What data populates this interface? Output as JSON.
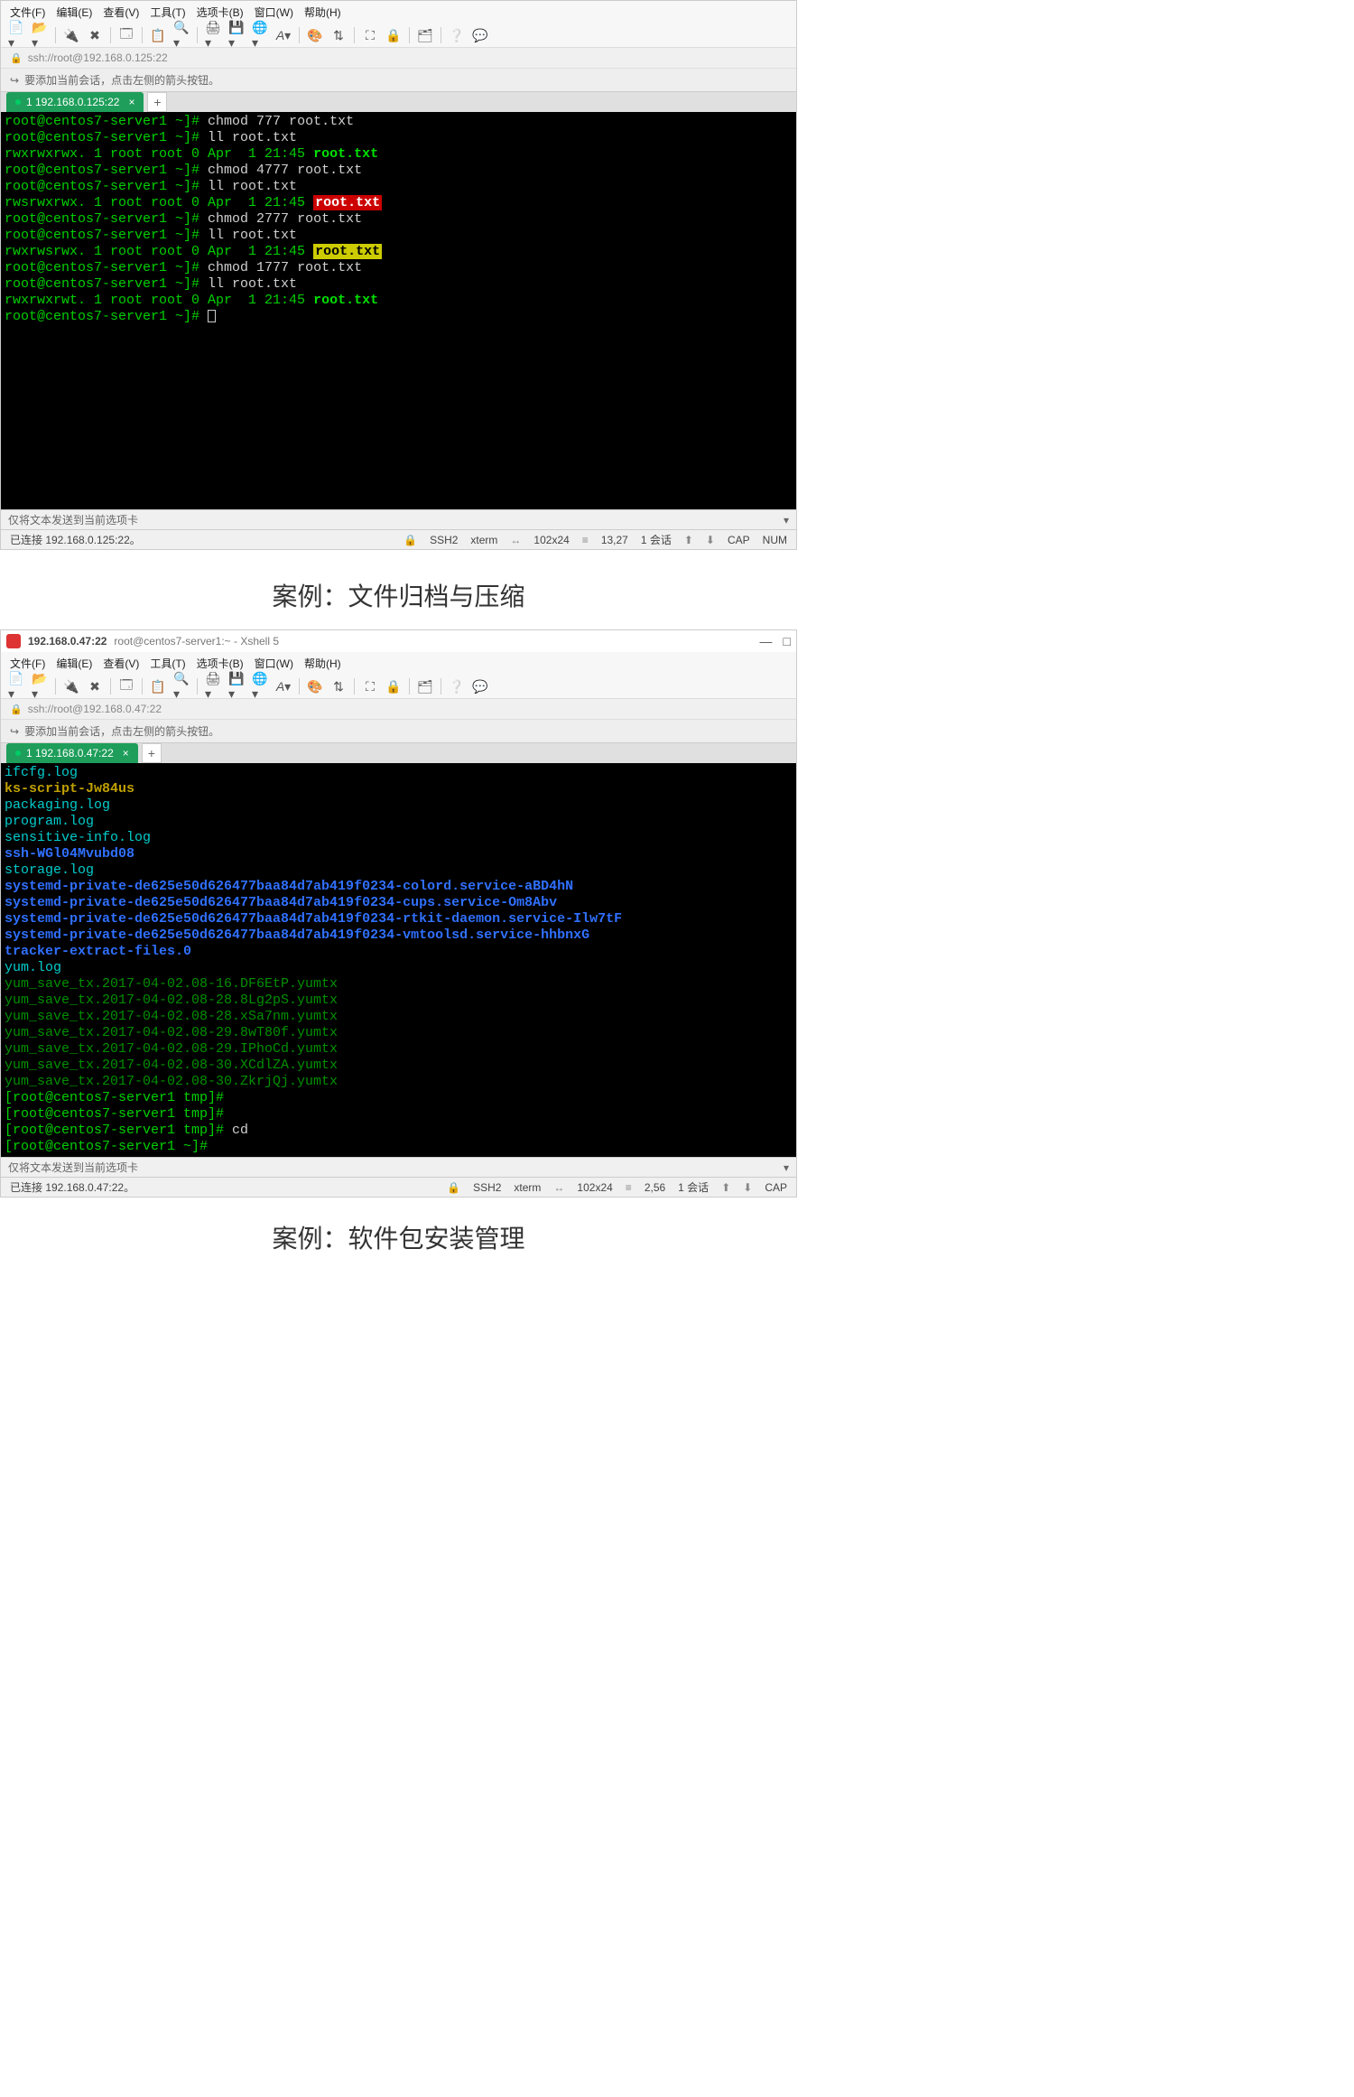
{
  "caption1": "案例：文件归档与压缩",
  "caption2": "案例：软件包安装管理",
  "menus": {
    "file": "文件(F)",
    "edit": "编辑(E)",
    "view": "查看(V)",
    "tools": "工具(T)",
    "tab": "选项卡(B)",
    "window": "窗口(W)",
    "help": "帮助(H)"
  },
  "win1": {
    "address": "ssh://root@192.168.0.125:22",
    "hint": "要添加当前会话，点击左侧的箭头按钮。",
    "tab_label": "1 192.168.0.125:22",
    "tab_plus": "+",
    "input_hint": "仅将文本发送到当前选项卡",
    "status_left": "已连接 192.168.0.125:22。",
    "status": {
      "ssh": "SSH2",
      "term": "xterm",
      "size": "102x24",
      "cursor": "13,27",
      "sess": "1 会话",
      "cap": "CAP",
      "num": "NUM"
    },
    "prompt": "root@centos7-server1 ~]# ",
    "lines": [
      {
        "t": "prompt",
        "cmd": "chmod 777 root.txt"
      },
      {
        "t": "prompt",
        "cmd": "ll root.txt"
      },
      {
        "t": "ls",
        "perm": "rwxrwxrwx. 1 root root 0 Apr  1 21:45 ",
        "file": "root.txt",
        "style": "bold"
      },
      {
        "t": "prompt",
        "cmd": "chmod 4777 root.txt"
      },
      {
        "t": "prompt",
        "cmd": "ll root.txt"
      },
      {
        "t": "ls",
        "perm": "rwsrwxrwx. 1 root root 0 Apr  1 21:45 ",
        "file": "root.txt",
        "style": "red"
      },
      {
        "t": "prompt",
        "cmd": "chmod 2777 root.txt"
      },
      {
        "t": "prompt",
        "cmd": "ll root.txt"
      },
      {
        "t": "ls",
        "perm": "rwxrwsrwx. 1 root root 0 Apr  1 21:45 ",
        "file": "root.txt",
        "style": "yellow"
      },
      {
        "t": "prompt",
        "cmd": "chmod 1777 root.txt"
      },
      {
        "t": "prompt",
        "cmd": "ll root.txt"
      },
      {
        "t": "ls",
        "perm": "rwxrwxrwt. 1 root root 0 Apr  1 21:45 ",
        "file": "root.txt",
        "style": "bold"
      },
      {
        "t": "prompt-cursor"
      }
    ]
  },
  "win2": {
    "title_host": "192.168.0.47:22",
    "title_rest": "root@centos7-server1:~ - Xshell 5",
    "address": "ssh://root@192.168.0.47:22",
    "hint": "要添加当前会话，点击左侧的箭头按钮。",
    "tab_label": "1 192.168.0.47:22",
    "tab_plus": "+",
    "input_hint": "仅将文本发送到当前选项卡",
    "status_left": "已连接 192.168.0.47:22。",
    "status": {
      "ssh": "SSH2",
      "term": "xterm",
      "size": "102x24",
      "cursor": "2,56",
      "sess": "1 会话",
      "cap": "CAP"
    },
    "prompt_tmp": "[root@centos7-server1 tmp]# ",
    "prompt_home": "[root@centos7-server1 ~]# ",
    "files": [
      {
        "name": "ifcfg.log",
        "style": "teal"
      },
      {
        "name": "ks-script-Jw84us",
        "style": "gold"
      },
      {
        "name": "packaging.log",
        "style": "teal"
      },
      {
        "name": "program.log",
        "style": "teal"
      },
      {
        "name": "sensitive-info.log",
        "style": "teal"
      },
      {
        "name": "ssh-WGl04Mvubd08",
        "style": "blue"
      },
      {
        "name": "storage.log",
        "style": "teal"
      },
      {
        "name": "systemd-private-de625e50d626477baa84d7ab419f0234-colord.service-aBD4hN",
        "style": "blue"
      },
      {
        "name": "systemd-private-de625e50d626477baa84d7ab419f0234-cups.service-Om8Abv",
        "style": "blue"
      },
      {
        "name": "systemd-private-de625e50d626477baa84d7ab419f0234-rtkit-daemon.service-Ilw7tF",
        "style": "blue"
      },
      {
        "name": "systemd-private-de625e50d626477baa84d7ab419f0234-vmtoolsd.service-hhbnxG",
        "style": "blue"
      },
      {
        "name": "tracker-extract-files.0",
        "style": "blue"
      },
      {
        "name": "yum.log",
        "style": "teal"
      },
      {
        "name": "yum_save_tx.2017-04-02.08-16.DF6EtP.yumtx",
        "style": "dark"
      },
      {
        "name": "yum_save_tx.2017-04-02.08-28.8Lg2pS.yumtx",
        "style": "dark"
      },
      {
        "name": "yum_save_tx.2017-04-02.08-28.xSa7nm.yumtx",
        "style": "dark"
      },
      {
        "name": "yum_save_tx.2017-04-02.08-29.8wT80f.yumtx",
        "style": "dark"
      },
      {
        "name": "yum_save_tx.2017-04-02.08-29.IPhoCd.yumtx",
        "style": "dark"
      },
      {
        "name": "yum_save_tx.2017-04-02.08-30.XCdlZA.yumtx",
        "style": "dark"
      },
      {
        "name": "yum_save_tx.2017-04-02.08-30.ZkrjQj.yumtx",
        "style": "dark"
      }
    ],
    "tail": [
      {
        "p": "tmp",
        "cmd": ""
      },
      {
        "p": "tmp",
        "cmd": ""
      },
      {
        "p": "tmp",
        "cmd": "cd"
      },
      {
        "p": "home",
        "cmd": ""
      }
    ]
  }
}
